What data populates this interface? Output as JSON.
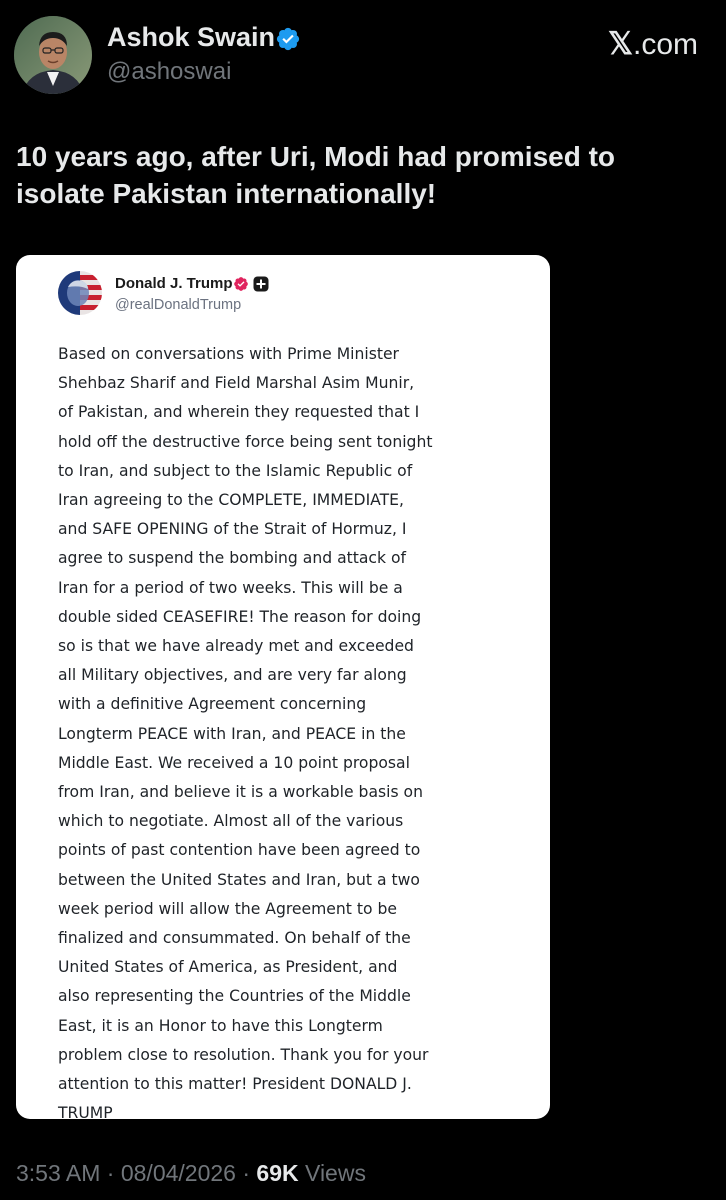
{
  "author": {
    "display_name": "Ashok Swain",
    "handle": "@ashoswai",
    "avatar_icon": "profile-photo",
    "verified_icon": "verified-badge-icon"
  },
  "brand": {
    "logo_text": "X.com",
    "color": "#e7e9ea"
  },
  "tweet": {
    "text": "10 years ago, after Uri, Modi had promised to\nisolate Pakistan internationally!"
  },
  "embedded_post": {
    "author_name": "Donald J. Trump",
    "author_handle": "@realDonaldTrump",
    "verified_icon": "verified-badge-icon",
    "extra_icon": "plus-square-icon",
    "body": "Based on conversations with Prime Minister\nShehbaz Sharif and Field Marshal Asim Munir,\nof Pakistan, and wherein they requested that I\nhold off the destructive force being sent tonight\nto Iran, and subject to the Islamic Republic of\nIran agreeing to the COMPLETE, IMMEDIATE,\nand SAFE OPENING of the Strait of Hormuz, I\nagree to suspend the bombing and attack of\nIran for a period of two weeks. This will be a\ndouble sided CEASEFIRE! The reason for doing\nso is that we have already met and exceeded\nall Military objectives, and are very far along\nwith a definitive Agreement concerning\nLongterm PEACE with Iran, and PEACE in the\nMiddle East. We received a 10 point proposal\nfrom Iran, and believe it is a workable basis on\nwhich to negotiate. Almost all of the various\npoints of past contention have been agreed to\nbetween the United States and Iran, but a two\nweek period will allow the Agreement to be\nfinalized and consummated. On behalf of the\nUnited States of America, as President, and\nalso representing the Countries of the Middle\nEast, it is an Honor to have this Longterm\nproblem close to resolution. Thank you for your\nattention to this matter! President DONALD J.\nTRUMP"
  },
  "meta": {
    "time": "3:53 AM",
    "separator": "·",
    "date": "08/04/2026",
    "views_count": "69K",
    "views_label": "Views"
  },
  "colors": {
    "background": "#000000",
    "primary_text": "#e7e9ea",
    "secondary_text": "#71767b",
    "verified_blue": "#1d9bf0",
    "embed_verified_pink": "#e0245e"
  }
}
